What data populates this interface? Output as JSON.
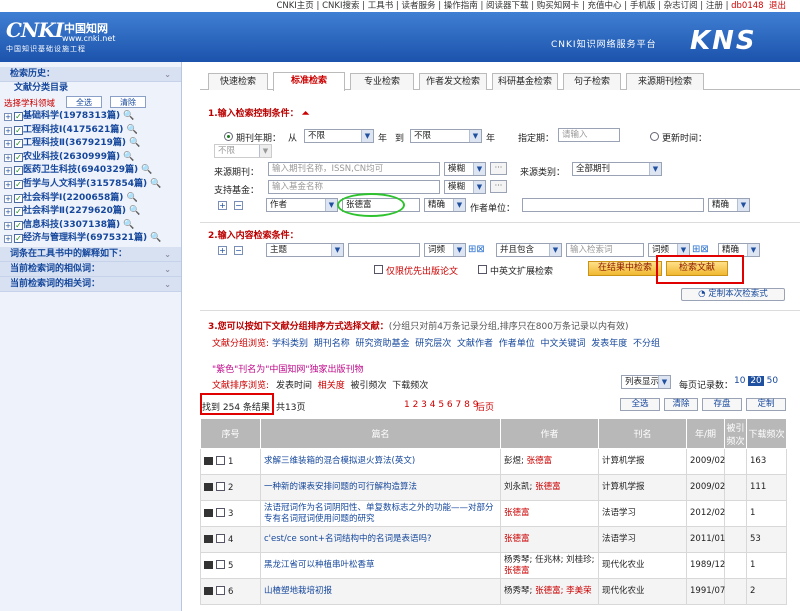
{
  "topnav": {
    "text": "CNKI主页 | CNKI搜索 | 工具书 | 读者服务 | 操作指南 | 阅读器下载 | 购买知网卡 | 充值中心 | 手机版 | 杂志订阅 | 注册 | ",
    "user": "db0148",
    "logout": "退出"
  },
  "banner": {
    "logo_main": "CNKI",
    "logo_cn": "中国知网",
    "logo_www": "www.cnki.net",
    "logo_sub": "中国知识基础设施工程",
    "platform": "CNKI知识网络服务平台",
    "brand": "KNS"
  },
  "sidebar": {
    "history": "检索历史：",
    "catalog": "文献分类目录",
    "choose_domain": "选择学科领域",
    "select_all": "全选",
    "clear": "清除",
    "items": [
      {
        "label": "基础科学",
        "count": "(1978313篇)"
      },
      {
        "label": "工程科技Ⅰ",
        "count": "(4175621篇)"
      },
      {
        "label": "工程科技Ⅱ",
        "count": "(3679219篇)"
      },
      {
        "label": "农业科技",
        "count": "(2630999篇)"
      },
      {
        "label": "医药卫生科技",
        "count": "(6940329篇)"
      },
      {
        "label": "哲学与人文科学",
        "count": "(3157854篇)"
      },
      {
        "label": "社会科学Ⅰ",
        "count": "(2200658篇)"
      },
      {
        "label": "社会科学Ⅱ",
        "count": "(2279620篇)"
      },
      {
        "label": "信息科技",
        "count": "(3307138篇)"
      },
      {
        "label": "经济与管理科学",
        "count": "(6975321篇)"
      }
    ],
    "panel1": "词条在工具书中的解释如下：",
    "panel2": "当前检索词的相似词：",
    "panel3": "当前检索词的相关词："
  },
  "tabs": [
    "快速检索",
    "标准检索",
    "专业检索",
    "作者发文检索",
    "科研基金检索",
    "句子检索",
    "来源期刊检索"
  ],
  "section1": {
    "title": "1.输入检索控制条件：",
    "period_label": "期刊年期：",
    "from": "从",
    "from_val": "不限",
    "year1": "年",
    "to": "到",
    "to_val": "不限",
    "year2": "年",
    "specify_label": "指定期：",
    "specify_ph": "请输入",
    "update_label": "更新时间：",
    "update_val": "不限",
    "source_label": "来源期刊：",
    "source_ph": "输入期刊名称，ISSN,CN均可",
    "fuzzy1": "模糊",
    "source_type_label": "来源类别：",
    "source_type_val": "全部期刊",
    "fund_label": "支持基金：",
    "fund_ph": "输入基金名称",
    "fuzzy2": "模糊",
    "author_field": "作者",
    "author_val": "张德富",
    "exact1": "精确",
    "org_label": "作者单位：",
    "exact2": "精确"
  },
  "section2": {
    "title": "2.输入内容检索条件：",
    "field": "主题",
    "freq": "词频",
    "and_contains": "并且包含",
    "term_ph": "输入检索词",
    "freq2": "词频",
    "exact": "精确",
    "opt1": "仅限优先出版论文",
    "opt2": "中英文扩展检索",
    "in_results": "在结果中检索",
    "search": "检索文献",
    "custom": "定制本次检索式"
  },
  "section3": {
    "title": "3.您可以按如下文献分组排序方式选择文献：",
    "note": "(分组只对前4万条记录分组,排序只在800万条记录以内有效)",
    "group_label": "文献分组浏览:",
    "groups": [
      "学科类别",
      "期刊名称",
      "研究资助基金",
      "研究层次",
      "文献作者",
      "作者单位",
      "中文关键词",
      "发表年度",
      "不分组"
    ],
    "promo": "\"紫色\"刊名为\"中国知网\"独家出版刊物",
    "sort_label": "文献排序浏览:",
    "sorts": [
      "发表时间",
      "相关度",
      "被引频次",
      "下载频次"
    ],
    "list_mode": "列表显示",
    "per_page_label": "每页记录数：",
    "per_page": [
      "10",
      "20",
      "50"
    ],
    "found": "找到 254 条结果",
    "pages_total": "共13页",
    "page_nums": "1 2 3 4 5 6 7 8 9",
    "next": "后页",
    "select_all": "全选",
    "clear": "清除",
    "save": "存盘",
    "custom": "定制"
  },
  "table": {
    "headers": [
      "序号",
      "篇名",
      "作者",
      "刊名",
      "年/期",
      "被引频次",
      "下载频次"
    ],
    "rows": [
      {
        "no": "1",
        "title": "求解三维装箱的混合模拟退火算法(英文)",
        "authors": "彭煜; ",
        "hl": "张德富",
        "journal": "计算机学报",
        "issue": "2009/02",
        "cite": "",
        "dl": "163"
      },
      {
        "no": "2",
        "title": "一种新的课表安排问题的可行解构造算法",
        "authors": "刘永凯; ",
        "hl": "张德富",
        "journal": "计算机学报",
        "issue": "2009/02",
        "cite": "",
        "dl": "111"
      },
      {
        "no": "3",
        "title": "法语冠词作为名词阴阳性、单复数标志之外的功能——对部分专有名词冠词使用问题的研究",
        "authors": "",
        "hl": "张德富",
        "journal": "法语学习",
        "issue": "2012/02",
        "cite": "",
        "dl": "1"
      },
      {
        "no": "4",
        "title": "c'est/ce sont+名词结构中的名词是表语吗?",
        "authors": "",
        "hl": "张德富",
        "journal": "法语学习",
        "issue": "2011/01",
        "cite": "",
        "dl": "53"
      },
      {
        "no": "5",
        "title": "黑龙江省可以种植串叶松香草",
        "authors": "杨秀琴; 任兆林; 刘桂珍; ",
        "hl": "张德富",
        "journal": "现代化农业",
        "issue": "1989/12",
        "cite": "",
        "dl": "1"
      },
      {
        "no": "6",
        "title": "山楂塑地栽培初报",
        "authors": "杨秀琴; ",
        "hl": "张德富; 李美荣",
        "journal": "现代化农业",
        "issue": "1991/07",
        "cite": "",
        "dl": "2"
      }
    ]
  },
  "colors": {
    "banner": "#1c53ac",
    "accent_red": "#e00000",
    "circle_green": "#2ec32e"
  }
}
